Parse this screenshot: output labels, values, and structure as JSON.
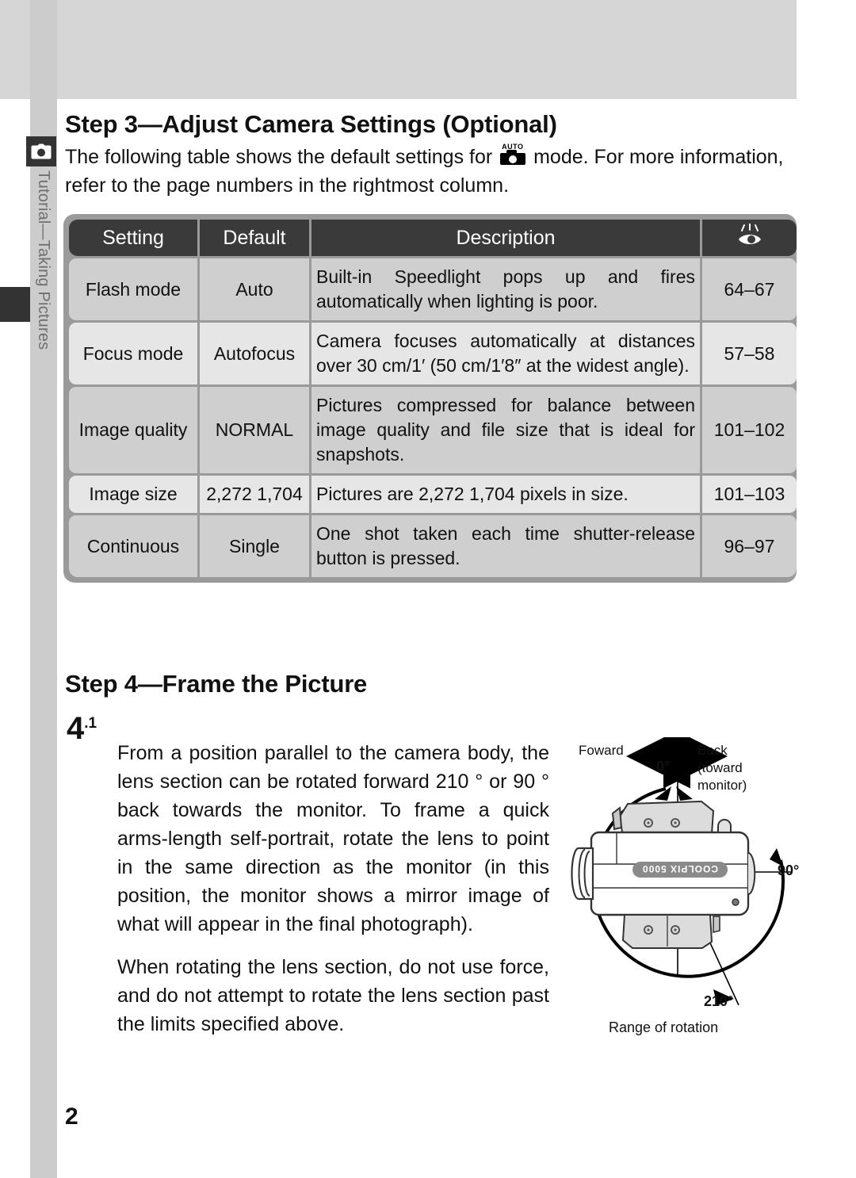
{
  "sidebar": {
    "camera_icon": "camera-icon",
    "label": "Tutorial—Taking Pictures"
  },
  "headings": {
    "step3": "Step 3—Adjust Camera Settings (Optional)",
    "step4": "Step 4—Frame the Picture"
  },
  "intro": {
    "before_icon": "The following table shows the default settings for ",
    "icon_name": "auto-mode-icon",
    "icon_text": "AUTO",
    "after_icon": " mode.  For more information, refer to the page numbers in the rightmost column."
  },
  "table": {
    "headers": {
      "setting": "Setting",
      "default": "Default",
      "description": "Description",
      "reference": "eye-reference-icon"
    },
    "rows": [
      {
        "setting": "Flash mode",
        "default": "Auto",
        "description": "Built-in Speedlight pops up and fires automatically when lighting is poor.",
        "pages": "64–67"
      },
      {
        "setting": "Focus mode",
        "default": "Autofocus",
        "description": "Camera focuses automatically at distances over 30 cm/1′ (50 cm/1′8″ at the widest angle).",
        "pages": "57–58"
      },
      {
        "setting": "Image quality",
        "default": "NORMAL",
        "description": "Pictures compressed for balance between image quality and file size that is ideal for snapshots.",
        "pages": "101–102"
      },
      {
        "setting": "Image size",
        "default": "2,272  1,704",
        "description": "Pictures are 2,272  1,704 pixels in size.",
        "pages": "101–103"
      },
      {
        "setting": "Continuous",
        "default": "Single",
        "description": "One shot taken each time shutter-release button is pressed.",
        "pages": "96–97"
      }
    ]
  },
  "step4": {
    "number": "4",
    "substep": ".1",
    "paragraph1": "From a position parallel to the camera body, the lens section can be rotated forward 210 ° or 90 ° back towards the monitor.  To frame a quick arms-length self-portrait, rotate the lens to point in the same direction as the monitor (in this position, the monitor shows a mirror image of what will appear in the final photograph).",
    "paragraph2": "When rotating the lens section, do not use force, and do not attempt to rotate the lens section past the limits specified above."
  },
  "figure": {
    "foward": "Foward",
    "back": "Back\n(toward\nmonitor)",
    "back_line1": "Back",
    "back_line2": "(toward",
    "back_line3": "monitor)",
    "zero_degrees": "0°",
    "ninety_degrees": "90°",
    "two_ten_degrees": "210°",
    "caption": "Range of rotation",
    "camera_brand": "COOLPIX 5000"
  },
  "page_number": "2",
  "colors": {
    "band_gray": "#d6d6d6",
    "sidebar_gray": "#cccccc",
    "tab_dark": "#333333",
    "header_dark": "#3a3a3a",
    "row_light": "#e6e6e6",
    "row_dark": "#cfcfcf",
    "table_border": "#9a9a9a",
    "highlight": "#cfcfcf"
  }
}
